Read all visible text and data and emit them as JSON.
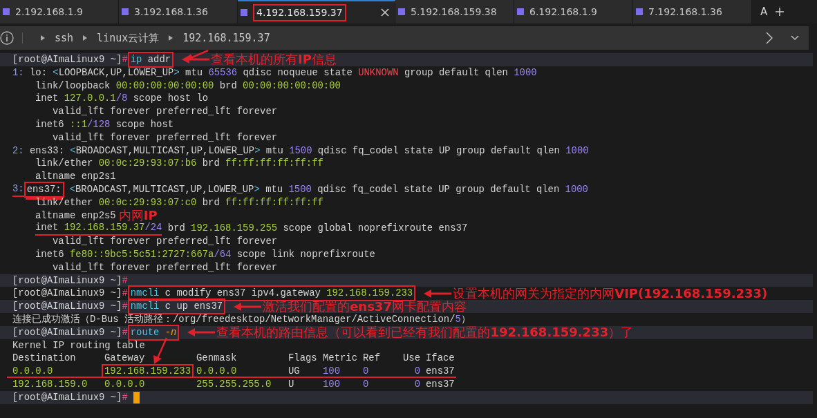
{
  "tabs": [
    {
      "label": "2.192.168.1.9",
      "selected": false,
      "boxed": false
    },
    {
      "label": "3.192.168.1.36",
      "selected": false,
      "boxed": false
    },
    {
      "label": "4.192.168.159.37",
      "selected": true,
      "boxed": true
    },
    {
      "label": "5.192.168.159.38",
      "selected": false,
      "boxed": false
    },
    {
      "label": "6.192.168.1.9",
      "selected": false,
      "boxed": false
    },
    {
      "label": "7.192.168.1.36",
      "selected": false,
      "boxed": false
    }
  ],
  "tab_bar_letter": "A",
  "breadcrumb": [
    "ssh",
    "linux云计算",
    "192.168.159.37"
  ],
  "lines": [
    {
      "kind": "prompt",
      "highlighted": true,
      "segments": [
        {
          "text": "[root@AImaLinux9 ~]",
          "kind": "plain"
        },
        {
          "text": "#",
          "kind": "hash"
        },
        {
          "kind": "box",
          "parts": [
            {
              "text": "ip",
              "kind": "command"
            },
            {
              "text": " addr",
              "kind": "plain"
            }
          ]
        }
      ],
      "note": {
        "text": "查看本机的所有**IP**信息",
        "arrow": true
      }
    },
    {
      "kind": "top",
      "segments": [
        {
          "text": "1:",
          "kind": "index"
        },
        {
          "text": " lo: ",
          "kind": "plain"
        },
        {
          "text": "<",
          "kind": "bracket"
        },
        {
          "text": "LOOPBACK,UP,LOWER_UP",
          "kind": "plain"
        },
        {
          "text": ">",
          "kind": "bracket"
        },
        {
          "text": " mtu ",
          "kind": "plain"
        },
        {
          "text": "65536",
          "kind": "number"
        },
        {
          "text": " qdisc noqueue state ",
          "kind": "plain"
        },
        {
          "text": "UNKNOWN",
          "kind": "alert"
        },
        {
          "text": " group default qlen ",
          "kind": "plain"
        },
        {
          "text": "1000",
          "kind": "number"
        }
      ]
    },
    {
      "kind": "detail",
      "segments": [
        {
          "text": "link/loopback ",
          "kind": "plain"
        },
        {
          "text": "00:00:00:00:00:00",
          "kind": "address"
        },
        {
          "text": " brd ",
          "kind": "plain"
        },
        {
          "text": "00:00:00:00:00:00",
          "kind": "address"
        }
      ]
    },
    {
      "kind": "detail",
      "segments": [
        {
          "text": "inet ",
          "kind": "plain"
        },
        {
          "text": "127.0.0.1",
          "kind": "address"
        },
        {
          "text": "/8",
          "kind": "number"
        },
        {
          "text": " scope host lo",
          "kind": "plain"
        }
      ]
    },
    {
      "kind": "lifetime",
      "segments": [
        {
          "text": "valid_lft forever preferred_lft forever",
          "kind": "plain"
        }
      ]
    },
    {
      "kind": "detail",
      "segments": [
        {
          "text": "inet6 ",
          "kind": "plain"
        },
        {
          "text": "::1",
          "kind": "address"
        },
        {
          "text": "/128",
          "kind": "number"
        },
        {
          "text": " scope host",
          "kind": "plain"
        }
      ]
    },
    {
      "kind": "lifetime",
      "segments": [
        {
          "text": "valid_lft forever preferred_lft forever",
          "kind": "plain"
        }
      ]
    },
    {
      "kind": "top",
      "segments": [
        {
          "text": "2:",
          "kind": "index"
        },
        {
          "text": " ens33: ",
          "kind": "plain"
        },
        {
          "text": "<",
          "kind": "bracket"
        },
        {
          "text": "BROADCAST,MULTICAST,UP,LOWER_UP",
          "kind": "plain"
        },
        {
          "text": ">",
          "kind": "bracket"
        },
        {
          "text": " mtu ",
          "kind": "plain"
        },
        {
          "text": "1500",
          "kind": "number"
        },
        {
          "text": " qdisc fq_codel state UP group default qlen ",
          "kind": "plain"
        },
        {
          "text": "1000",
          "kind": "number"
        }
      ]
    },
    {
      "kind": "detail",
      "segments": [
        {
          "text": "link/ether ",
          "kind": "plain"
        },
        {
          "text": "00:0c:29:93:07:b6",
          "kind": "address"
        },
        {
          "text": " brd ",
          "kind": "plain"
        },
        {
          "text": "ff:ff:ff:ff:ff:ff",
          "kind": "address"
        }
      ]
    },
    {
      "kind": "detail",
      "segments": [
        {
          "text": "altname enp2s1",
          "kind": "plain"
        }
      ]
    },
    {
      "kind": "top",
      "segments": [
        {
          "text": "3:",
          "kind": "index",
          "underlined": true
        },
        {
          "kind": "box",
          "underlined": true,
          "parts": [
            {
              "text": "ens37:",
              "kind": "plain"
            }
          ]
        },
        {
          "text": "<",
          "kind": "bracket"
        },
        {
          "text": "BROADCAST,MULTICAST,UP,LOWER_UP",
          "kind": "plain"
        },
        {
          "text": ">",
          "kind": "bracket"
        },
        {
          "text": " mtu ",
          "kind": "plain"
        },
        {
          "text": "1500",
          "kind": "number"
        },
        {
          "text": " qdisc fq_codel state UP group default qlen ",
          "kind": "plain"
        },
        {
          "text": "1000",
          "kind": "number"
        }
      ]
    },
    {
      "kind": "detail",
      "segments": [
        {
          "text": "link/ether ",
          "kind": "plain"
        },
        {
          "text": "00:0c:29:93:07:c0",
          "kind": "address"
        },
        {
          "text": " brd ",
          "kind": "plain"
        },
        {
          "text": "ff:ff:ff:ff:ff:ff",
          "kind": "address"
        }
      ]
    },
    {
      "kind": "detail",
      "segments": [
        {
          "text": "altname enp2s5",
          "kind": "plain"
        }
      ],
      "note": {
        "text": "内网**IP**",
        "arrow": false
      }
    },
    {
      "kind": "detail",
      "segments": [
        {
          "text": "inet ",
          "kind": "plain",
          "underlined": true
        },
        {
          "text": "192.168.159.37",
          "kind": "address",
          "underlined": true
        },
        {
          "text": "/24",
          "kind": "number",
          "underlined": true
        },
        {
          "text": " brd ",
          "kind": "plain"
        },
        {
          "text": "192.168.159.255",
          "kind": "address"
        },
        {
          "text": " scope global noprefixroute ens37",
          "kind": "plain"
        }
      ]
    },
    {
      "kind": "lifetime",
      "segments": [
        {
          "text": "valid_lft forever preferred_lft forever",
          "kind": "plain"
        }
      ]
    },
    {
      "kind": "detail",
      "segments": [
        {
          "text": "inet6 ",
          "kind": "plain"
        },
        {
          "text": "fe80::9bc5:5c51:2727:667a",
          "kind": "address"
        },
        {
          "text": "/64",
          "kind": "number"
        },
        {
          "text": " scope link noprefixroute",
          "kind": "plain"
        }
      ]
    },
    {
      "kind": "lifetime",
      "segments": [
        {
          "text": "valid_lft forever preferred_lft forever",
          "kind": "plain"
        }
      ]
    },
    {
      "kind": "prompt",
      "highlighted": true,
      "segments": [
        {
          "text": "[root@AImaLinux9 ~]",
          "kind": "plain"
        },
        {
          "text": "#",
          "kind": "hash"
        }
      ]
    },
    {
      "kind": "prompt",
      "highlighted": false,
      "segments": [
        {
          "text": "[root@AImaLinux9 ~]",
          "kind": "plain"
        },
        {
          "text": "#",
          "kind": "hash"
        },
        {
          "kind": "box",
          "parts": [
            {
              "text": "nmcli",
              "kind": "command"
            },
            {
              "text": " c modify ens37 ipv4.gateway ",
              "kind": "plain"
            },
            {
              "text": "192.168.159.233",
              "kind": "address"
            }
          ]
        }
      ],
      "note": {
        "text": "设置本机的网关为指定的内网**VIP(192.168.159.233)**",
        "arrow": true
      }
    },
    {
      "kind": "prompt",
      "highlighted": true,
      "segments": [
        {
          "text": "[root@AImaLinux9 ~]",
          "kind": "plain"
        },
        {
          "text": "#",
          "kind": "hash"
        },
        {
          "kind": "box",
          "parts": [
            {
              "text": "nmcli",
              "kind": "command"
            },
            {
              "text": " c up ens37",
              "kind": "plain"
            }
          ]
        }
      ],
      "note": {
        "text": "激活我们配置的**ens37**网卡配置内容",
        "arrow": true
      }
    },
    {
      "kind": "output",
      "segments": [
        {
          "text": "连接已成功激活（D-Bus 活动路径：/org/freedesktop/NetworkManager/ActiveConnection/",
          "kind": "plain"
        },
        {
          "text": "5",
          "kind": "number"
        },
        {
          "text": "）",
          "kind": "plain"
        }
      ]
    },
    {
      "kind": "prompt",
      "highlighted": true,
      "segments": [
        {
          "text": "[root@AImaLinux9 ~]",
          "kind": "plain"
        },
        {
          "text": "#",
          "kind": "hash"
        },
        {
          "kind": "box",
          "parts": [
            {
              "text": "route",
              "kind": "command"
            },
            {
              "text": "-n",
              "kind": "flag"
            }
          ]
        }
      ],
      "note": {
        "text": "查看本机的路由信息（可以看到已经有我们配置的**192.168.159.233**）了",
        "arrow": true
      }
    },
    {
      "kind": "output",
      "segments": [
        {
          "text": "Kernel IP routing table",
          "kind": "plain"
        }
      ]
    },
    {
      "kind": "table_header",
      "cells": [
        {
          "text": "Destination",
          "kind": "plain"
        },
        {
          "text": "Gateway",
          "kind": "plain"
        },
        {
          "text": "Genmask",
          "kind": "plain"
        },
        {
          "text": "Flags",
          "kind": "plain"
        },
        {
          "text": "Metric",
          "kind": "plain"
        },
        {
          "text": "Ref",
          "kind": "plain"
        },
        {
          "text": "Use",
          "kind": "plain"
        },
        {
          "text": "Iface",
          "kind": "plain"
        }
      ]
    },
    {
      "kind": "table_row",
      "underlined": true,
      "cells": [
        {
          "text": "0.0.0.0",
          "kind": "address"
        },
        {
          "text": "192.168.159.233",
          "kind": "address",
          "boxed": true
        },
        {
          "text": "0.0.0.0",
          "kind": "address"
        },
        {
          "text": "UG",
          "kind": "plain"
        },
        {
          "text": "100",
          "kind": "number"
        },
        {
          "text": "0",
          "kind": "number"
        },
        {
          "text": "0",
          "kind": "number"
        },
        {
          "text": "ens37",
          "kind": "plain"
        }
      ]
    },
    {
      "kind": "table_row",
      "underlined": false,
      "cells": [
        {
          "text": "192.168.159.0",
          "kind": "address"
        },
        {
          "text": "0.0.0.0",
          "kind": "address"
        },
        {
          "text": "255.255.255.0",
          "kind": "address"
        },
        {
          "text": "U",
          "kind": "plain"
        },
        {
          "text": "100",
          "kind": "number"
        },
        {
          "text": "0",
          "kind": "number"
        },
        {
          "text": "0",
          "kind": "number"
        },
        {
          "text": "ens37",
          "kind": "plain"
        }
      ]
    },
    {
      "kind": "prompt",
      "highlighted": true,
      "cursor": true,
      "segments": [
        {
          "text": "[root@AImaLinux9 ~]",
          "kind": "plain"
        },
        {
          "text": "#",
          "kind": "hash"
        }
      ]
    }
  ]
}
